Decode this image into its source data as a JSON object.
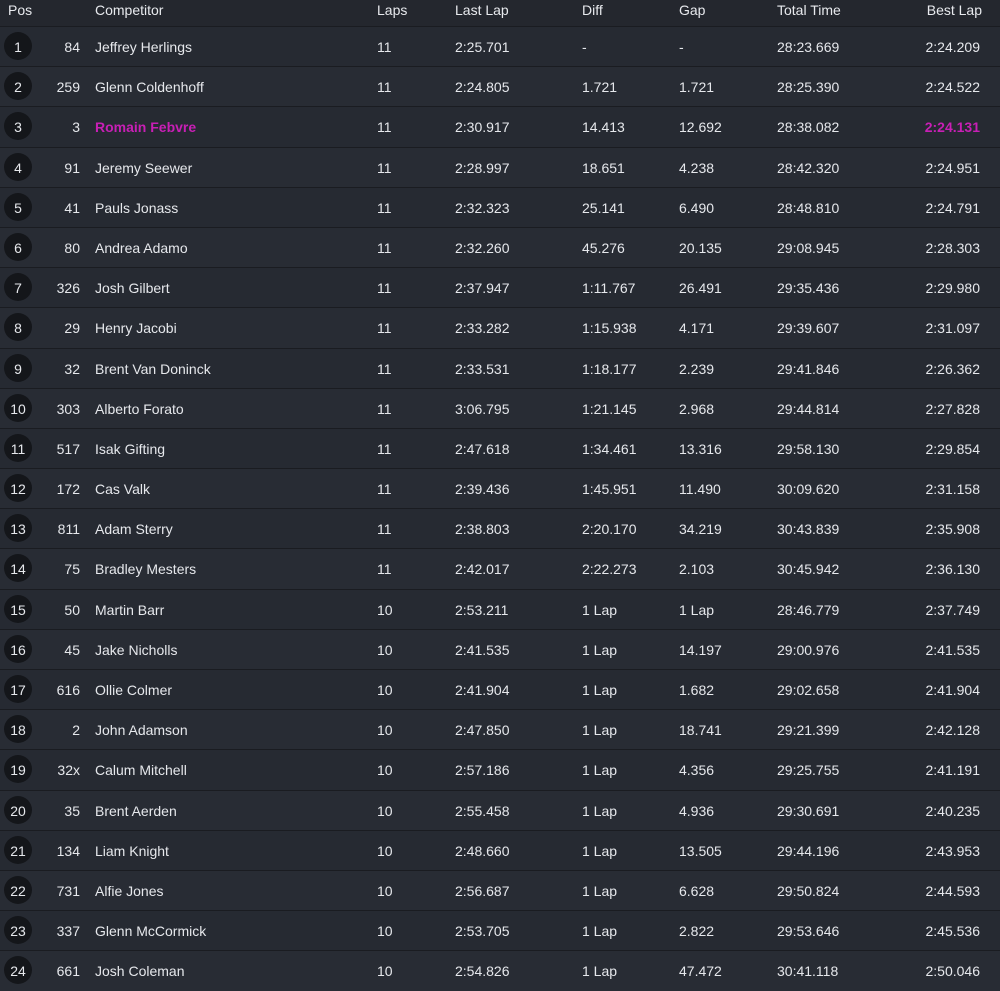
{
  "columns": {
    "pos": "Pos",
    "competitor": "Competitor",
    "laps": "Laps",
    "last_lap": "Last Lap",
    "diff": "Diff",
    "gap": "Gap",
    "total_time": "Total Time",
    "best_lap": "Best Lap"
  },
  "colors": {
    "background": "#24272e",
    "highlight": "#c81fb5",
    "badge": "#14161a"
  },
  "rows": [
    {
      "pos": "1",
      "num": "84",
      "name": "Jeffrey Herlings",
      "laps": "11",
      "last_lap": "2:25.701",
      "diff": "-",
      "gap": "-",
      "total": "28:23.669",
      "best": "2:24.209"
    },
    {
      "pos": "2",
      "num": "259",
      "name": "Glenn Coldenhoff",
      "laps": "11",
      "last_lap": "2:24.805",
      "diff": "1.721",
      "gap": "1.721",
      "total": "28:25.390",
      "best": "2:24.522"
    },
    {
      "pos": "3",
      "num": "3",
      "name": "Romain Febvre",
      "laps": "11",
      "last_lap": "2:30.917",
      "diff": "14.413",
      "gap": "12.692",
      "total": "28:38.082",
      "best": "2:24.131",
      "highlight": true
    },
    {
      "pos": "4",
      "num": "91",
      "name": "Jeremy Seewer",
      "laps": "11",
      "last_lap": "2:28.997",
      "diff": "18.651",
      "gap": "4.238",
      "total": "28:42.320",
      "best": "2:24.951"
    },
    {
      "pos": "5",
      "num": "41",
      "name": "Pauls Jonass",
      "laps": "11",
      "last_lap": "2:32.323",
      "diff": "25.141",
      "gap": "6.490",
      "total": "28:48.810",
      "best": "2:24.791"
    },
    {
      "pos": "6",
      "num": "80",
      "name": "Andrea Adamo",
      "laps": "11",
      "last_lap": "2:32.260",
      "diff": "45.276",
      "gap": "20.135",
      "total": "29:08.945",
      "best": "2:28.303"
    },
    {
      "pos": "7",
      "num": "326",
      "name": "Josh Gilbert",
      "laps": "11",
      "last_lap": "2:37.947",
      "diff": "1:11.767",
      "gap": "26.491",
      "total": "29:35.436",
      "best": "2:29.980"
    },
    {
      "pos": "8",
      "num": "29",
      "name": "Henry Jacobi",
      "laps": "11",
      "last_lap": "2:33.282",
      "diff": "1:15.938",
      "gap": "4.171",
      "total": "29:39.607",
      "best": "2:31.097"
    },
    {
      "pos": "9",
      "num": "32",
      "name": "Brent Van Doninck",
      "laps": "11",
      "last_lap": "2:33.531",
      "diff": "1:18.177",
      "gap": "2.239",
      "total": "29:41.846",
      "best": "2:26.362"
    },
    {
      "pos": "10",
      "num": "303",
      "name": "Alberto Forato",
      "laps": "11",
      "last_lap": "3:06.795",
      "diff": "1:21.145",
      "gap": "2.968",
      "total": "29:44.814",
      "best": "2:27.828"
    },
    {
      "pos": "11",
      "num": "517",
      "name": "Isak Gifting",
      "laps": "11",
      "last_lap": "2:47.618",
      "diff": "1:34.461",
      "gap": "13.316",
      "total": "29:58.130",
      "best": "2:29.854"
    },
    {
      "pos": "12",
      "num": "172",
      "name": "Cas Valk",
      "laps": "11",
      "last_lap": "2:39.436",
      "diff": "1:45.951",
      "gap": "11.490",
      "total": "30:09.620",
      "best": "2:31.158"
    },
    {
      "pos": "13",
      "num": "811",
      "name": "Adam Sterry",
      "laps": "11",
      "last_lap": "2:38.803",
      "diff": "2:20.170",
      "gap": "34.219",
      "total": "30:43.839",
      "best": "2:35.908"
    },
    {
      "pos": "14",
      "num": "75",
      "name": "Bradley Mesters",
      "laps": "11",
      "last_lap": "2:42.017",
      "diff": "2:22.273",
      "gap": "2.103",
      "total": "30:45.942",
      "best": "2:36.130"
    },
    {
      "pos": "15",
      "num": "50",
      "name": "Martin Barr",
      "laps": "10",
      "last_lap": "2:53.211",
      "diff": "1 Lap",
      "gap": "1 Lap",
      "total": "28:46.779",
      "best": "2:37.749"
    },
    {
      "pos": "16",
      "num": "45",
      "name": "Jake Nicholls",
      "laps": "10",
      "last_lap": "2:41.535",
      "diff": "1 Lap",
      "gap": "14.197",
      "total": "29:00.976",
      "best": "2:41.535"
    },
    {
      "pos": "17",
      "num": "616",
      "name": "Ollie Colmer",
      "laps": "10",
      "last_lap": "2:41.904",
      "diff": "1 Lap",
      "gap": "1.682",
      "total": "29:02.658",
      "best": "2:41.904"
    },
    {
      "pos": "18",
      "num": "2",
      "name": "John Adamson",
      "laps": "10",
      "last_lap": "2:47.850",
      "diff": "1 Lap",
      "gap": "18.741",
      "total": "29:21.399",
      "best": "2:42.128"
    },
    {
      "pos": "19",
      "num": "32x",
      "name": "Calum Mitchell",
      "laps": "10",
      "last_lap": "2:57.186",
      "diff": "1 Lap",
      "gap": "4.356",
      "total": "29:25.755",
      "best": "2:41.191"
    },
    {
      "pos": "20",
      "num": "35",
      "name": "Brent Aerden",
      "laps": "10",
      "last_lap": "2:55.458",
      "diff": "1 Lap",
      "gap": "4.936",
      "total": "29:30.691",
      "best": "2:40.235"
    },
    {
      "pos": "21",
      "num": "134",
      "name": "Liam Knight",
      "laps": "10",
      "last_lap": "2:48.660",
      "diff": "1 Lap",
      "gap": "13.505",
      "total": "29:44.196",
      "best": "2:43.953"
    },
    {
      "pos": "22",
      "num": "731",
      "name": "Alfie Jones",
      "laps": "10",
      "last_lap": "2:56.687",
      "diff": "1 Lap",
      "gap": "6.628",
      "total": "29:50.824",
      "best": "2:44.593"
    },
    {
      "pos": "23",
      "num": "337",
      "name": "Glenn McCormick",
      "laps": "10",
      "last_lap": "2:53.705",
      "diff": "1 Lap",
      "gap": "2.822",
      "total": "29:53.646",
      "best": "2:45.536"
    },
    {
      "pos": "24",
      "num": "661",
      "name": "Josh Coleman",
      "laps": "10",
      "last_lap": "2:54.826",
      "diff": "1 Lap",
      "gap": "47.472",
      "total": "30:41.118",
      "best": "2:50.046"
    }
  ]
}
